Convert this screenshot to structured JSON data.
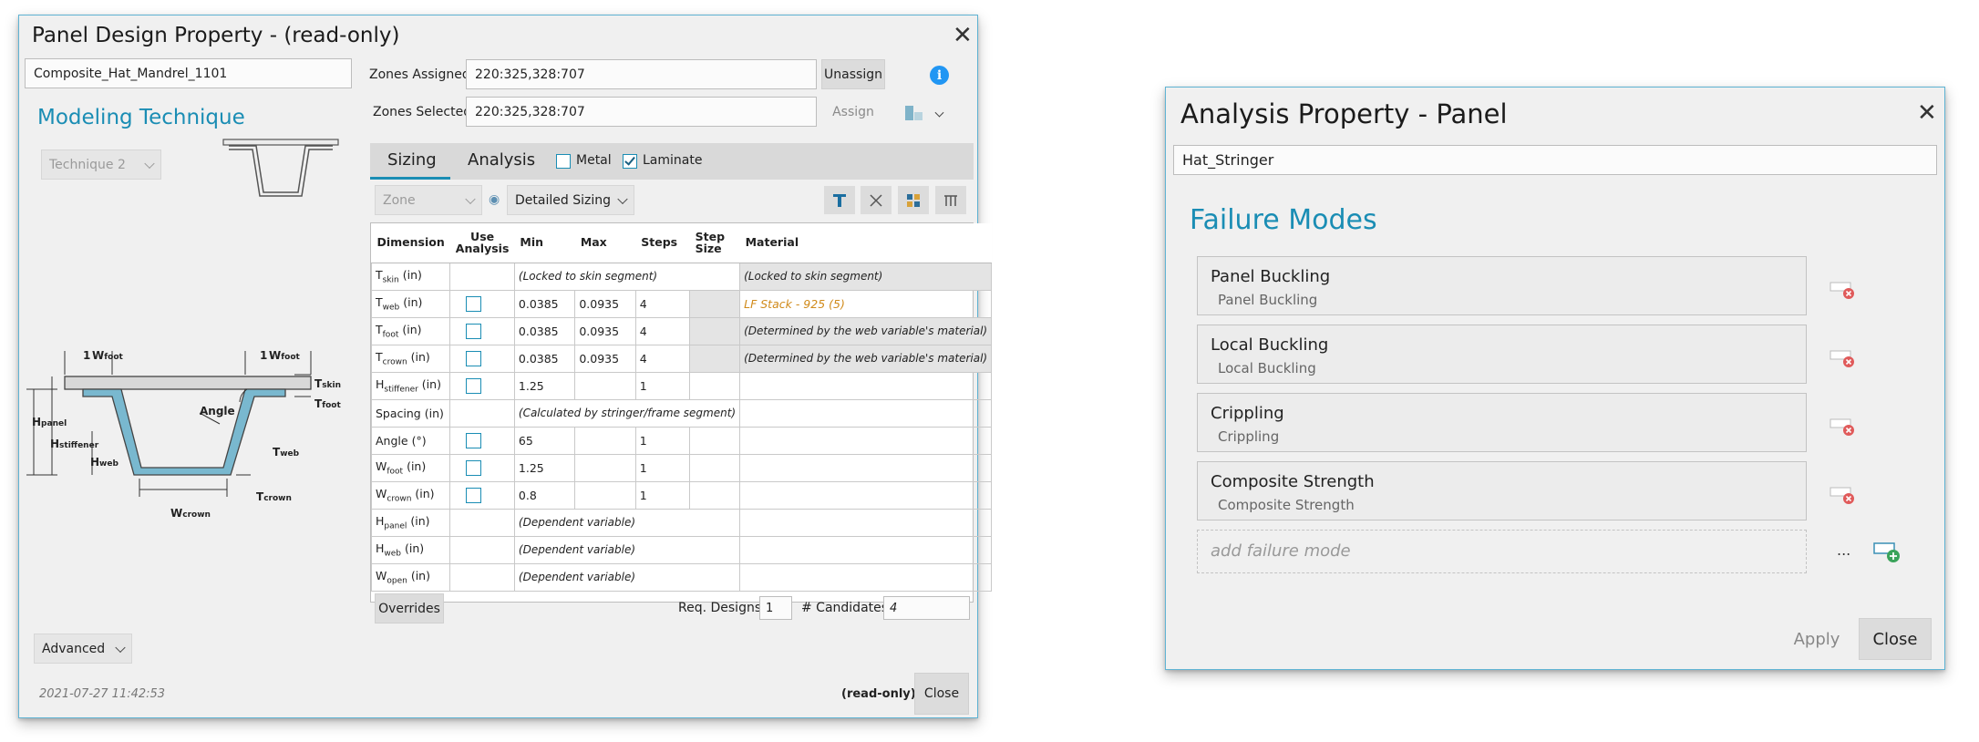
{
  "panel_design": {
    "title": "Panel Design Property - (read-only)",
    "name_value": "Composite_Hat_Mandrel_1101",
    "modeling_technique_heading": "Modeling Technique",
    "technique_value": "Technique 2",
    "zones_assigned_label": "Zones Assigned:",
    "zones_assigned_value": "220:325,328:707",
    "zones_selected_label": "Zones Selected:",
    "zones_selected_value": "220:325,328:707",
    "unassign_label": "Unassign",
    "assign_label": "Assign",
    "tabs": [
      "Sizing",
      "Analysis"
    ],
    "metal_label": "Metal",
    "metal_checked": false,
    "laminate_label": "Laminate",
    "laminate_checked": true,
    "zone_combo": "Zone",
    "sizing_combo": "Detailed Sizing",
    "columns": [
      "Dimension",
      "Use Analysis",
      "Min",
      "Max",
      "Steps",
      "Step Size",
      "Material"
    ],
    "rows": [
      {
        "dim": "T",
        "sub": "skin",
        "unit": "(in)",
        "min": "",
        "max": "",
        "steps": "",
        "note": "(Locked to skin segment)",
        "material": "(Locked to skin segment)"
      },
      {
        "dim": "T",
        "sub": "web",
        "unit": "(in)",
        "min": "0.0385",
        "max": "0.0935",
        "steps": "4",
        "material": "LF Stack - 925 (5)"
      },
      {
        "dim": "T",
        "sub": "foot",
        "unit": "(in)",
        "min": "0.0385",
        "max": "0.0935",
        "steps": "4",
        "material": "(Determined by the web variable's material)"
      },
      {
        "dim": "T",
        "sub": "crown",
        "unit": "(in)",
        "min": "0.0385",
        "max": "0.0935",
        "steps": "4",
        "material": "(Determined by the web variable's material)"
      },
      {
        "dim": "H",
        "sub": "stiffener",
        "unit": "(in)",
        "min": "1.25",
        "max": "",
        "steps": "1",
        "material": ""
      },
      {
        "dim": "Spacing",
        "sub": "",
        "unit": "(in)",
        "note": "(Calculated by stringer/frame segment)"
      },
      {
        "dim": "Angle",
        "sub": "",
        "unit": "(°)",
        "min": "65",
        "max": "",
        "steps": "1",
        "material": ""
      },
      {
        "dim": "W",
        "sub": "foot",
        "unit": "(in)",
        "min": "1.25",
        "max": "",
        "steps": "1",
        "material": ""
      },
      {
        "dim": "W",
        "sub": "crown",
        "unit": "(in)",
        "min": "0.8",
        "max": "",
        "steps": "1",
        "material": ""
      },
      {
        "dim": "H",
        "sub": "panel",
        "unit": "(in)",
        "note": "(Dependent variable)"
      },
      {
        "dim": "H",
        "sub": "web",
        "unit": "(in)",
        "note": "(Dependent variable)"
      },
      {
        "dim": "W",
        "sub": "open",
        "unit": "(in)",
        "note": "(Dependent variable)"
      }
    ],
    "overrides_label": "Overrides",
    "req_designs_label": "Req. Designs",
    "req_designs_value": "1",
    "candidates_label": "# Candidates",
    "candidates_value": "4",
    "advanced_label": "Advanced",
    "timestamp": "2021-07-27 11:42:53",
    "readonly_label": "(read-only)",
    "close_label": "Close",
    "diagram_labels": {
      "frac": "1",
      "frac_den": "2",
      "w": "W",
      "foot": "foot",
      "t": "T",
      "skin": "skin",
      "h": "H",
      "panel": "panel",
      "stiffener": "stiffener",
      "web": "web",
      "crown": "crown",
      "angle": "Angle"
    }
  },
  "analysis_property": {
    "title": "Analysis Property - Panel",
    "name_value": "Hat_Stringer",
    "heading": "Failure Modes",
    "failure_modes": [
      {
        "name": "Panel Buckling",
        "sub": "Panel Buckling"
      },
      {
        "name": "Local Buckling",
        "sub": "Local Buckling"
      },
      {
        "name": "Crippling",
        "sub": "Crippling"
      },
      {
        "name": "Composite Strength",
        "sub": "Composite Strength"
      }
    ],
    "add_placeholder": "add failure mode",
    "ellipsis": "...",
    "apply_label": "Apply",
    "close_label": "Close"
  },
  "colors": {
    "accent": "#1a8db4",
    "border": "#5fb3d3",
    "orange": "#d08a1a",
    "remove": "#e05a5a",
    "add": "#3aa35a"
  },
  "icons": [
    "close-icon",
    "info-icon",
    "chevron-down-icon",
    "eye-icon",
    "remove-icon",
    "add-icon"
  ]
}
